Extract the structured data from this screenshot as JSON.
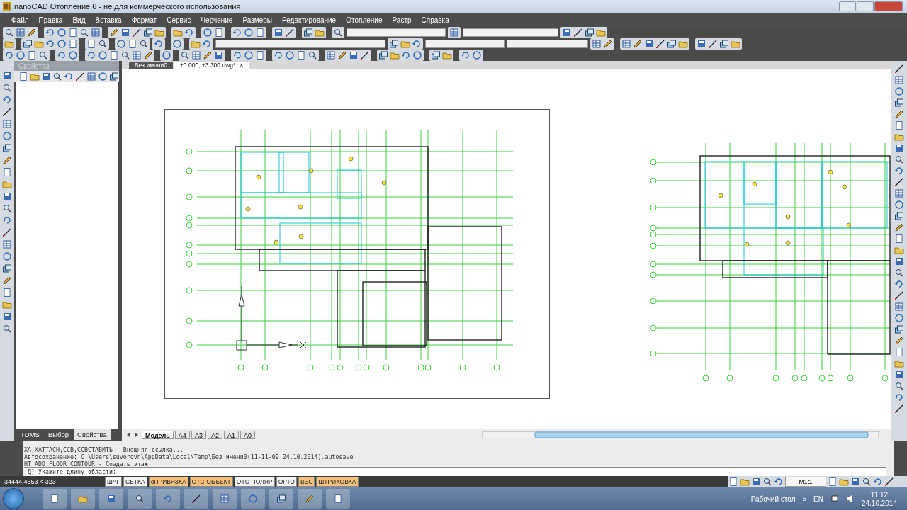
{
  "window": {
    "title": "nanoCAD Отопление 6 - не для коммерческого использования"
  },
  "menu": [
    "Файл",
    "Правка",
    "Вид",
    "Вставка",
    "Формат",
    "Сервис",
    "Черчение",
    "Размеры",
    "Редактирование",
    "Отопление",
    "Растр",
    "Справка"
  ],
  "properties_panel": {
    "title": "Свойства",
    "tabs": [
      {
        "label": "TDMS",
        "selected": false
      },
      {
        "label": "Выбор",
        "selected": false
      },
      {
        "label": "Свойства",
        "selected": true
      }
    ]
  },
  "document_tabs": [
    {
      "label": "Без имени0",
      "selected": false
    },
    {
      "label": "+0.000, +3.300.dwg*",
      "selected": true,
      "close": "×"
    }
  ],
  "layout_tabs": [
    {
      "label": "Модель",
      "selected": true
    },
    {
      "label": "A4",
      "selected": false
    },
    {
      "label": "A3",
      "selected": false
    },
    {
      "label": "A2",
      "selected": false
    },
    {
      "label": "A1",
      "selected": false
    },
    {
      "label": "A0",
      "selected": false
    }
  ],
  "command_line": {
    "history": [
      "XA,XATTACH,ССВ,ССВСТАВИТЬ - Внешняя ссылка...",
      "Автосохранение: C:\\Users\\suvorovn\\AppData\\Local\\Temp\\Без имени0(11-11-09_24.10.2014).autosave",
      "HT_ADD_FLOOR_CONTOUR - Создать этаж"
    ],
    "prompt": "(Д) Укажите длину области:"
  },
  "status_bar": {
    "coordinates": "34444.4353 < 323",
    "toggles": [
      {
        "label": "ШАГ",
        "on": false
      },
      {
        "label": "СЕТКА",
        "on": false
      },
      {
        "label": "оПРИВЯЗКА",
        "on": true
      },
      {
        "label": "ОТС-ОБЪЕКТ",
        "on": true
      },
      {
        "label": "ОТС-ПОЛЯР",
        "on": false
      },
      {
        "label": "ОРТО",
        "on": false
      },
      {
        "label": "ВЕС",
        "on": true
      },
      {
        "label": "ШТРИХОВКА",
        "on": true
      }
    ],
    "scale": "M1:1"
  },
  "taskbar": {
    "desktop": "Рабочий стол",
    "chevron": "»",
    "language": "EN",
    "time": "11:12",
    "date": "24.10.2014"
  }
}
